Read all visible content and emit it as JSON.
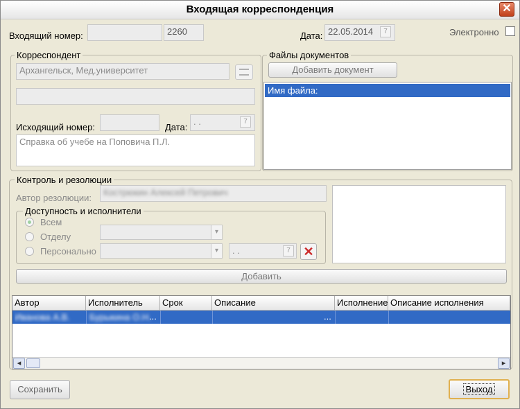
{
  "window": {
    "title": "Входящая корреспонденция"
  },
  "header": {
    "incoming_number_label": "Входящий номер:",
    "incoming_number_value": "2260",
    "date_label": "Дата:",
    "date_value": "22.05.2014",
    "electronic_label": "Электронно"
  },
  "correspondent": {
    "legend": "Корреспондент",
    "name_value": "Архангельск, Мед.университет",
    "outgoing_label": "Исходящий номер:",
    "date_label": "Дата:",
    "date_value": ". .",
    "description": "Справка об учебе на Поповича П.Л."
  },
  "files": {
    "legend": "Файлы документов",
    "add_button": "Добавить документ",
    "list_header": "Имя файла:"
  },
  "control": {
    "legend": "Контроль и резолюции",
    "author_label": "Автор резолюции:",
    "author_value": "Кострюкин Алексей Петрович",
    "access_legend": "Доступность и исполнители",
    "radio_all": "Всем",
    "radio_dept": "Отделу",
    "radio_personal": "Персонально",
    "date_value": ". .",
    "add_button": "Добавить"
  },
  "table": {
    "columns": [
      "Автор",
      "Исполнитель",
      "Срок",
      "Описание",
      "Исполнение",
      "Описание исполнения"
    ],
    "rows": [
      {
        "author": "Иванова А.В.",
        "executor": "Бурыкина О.Н.",
        "executor_more": "...",
        "term": "",
        "description": "",
        "description_more": "...",
        "execution": "",
        "execution_desc": ""
      }
    ]
  },
  "footer": {
    "save_button": "Сохранить",
    "exit_button": "Выход"
  },
  "icons": {
    "close": "✕",
    "calendar": "7",
    "dropdown": "▾",
    "scroll_left": "◂",
    "scroll_right": "▸",
    "delete": "✕"
  },
  "colors": {
    "selection": "#316ac5",
    "close_button": "#c1401c",
    "delete_icon": "#cc2a2a"
  }
}
